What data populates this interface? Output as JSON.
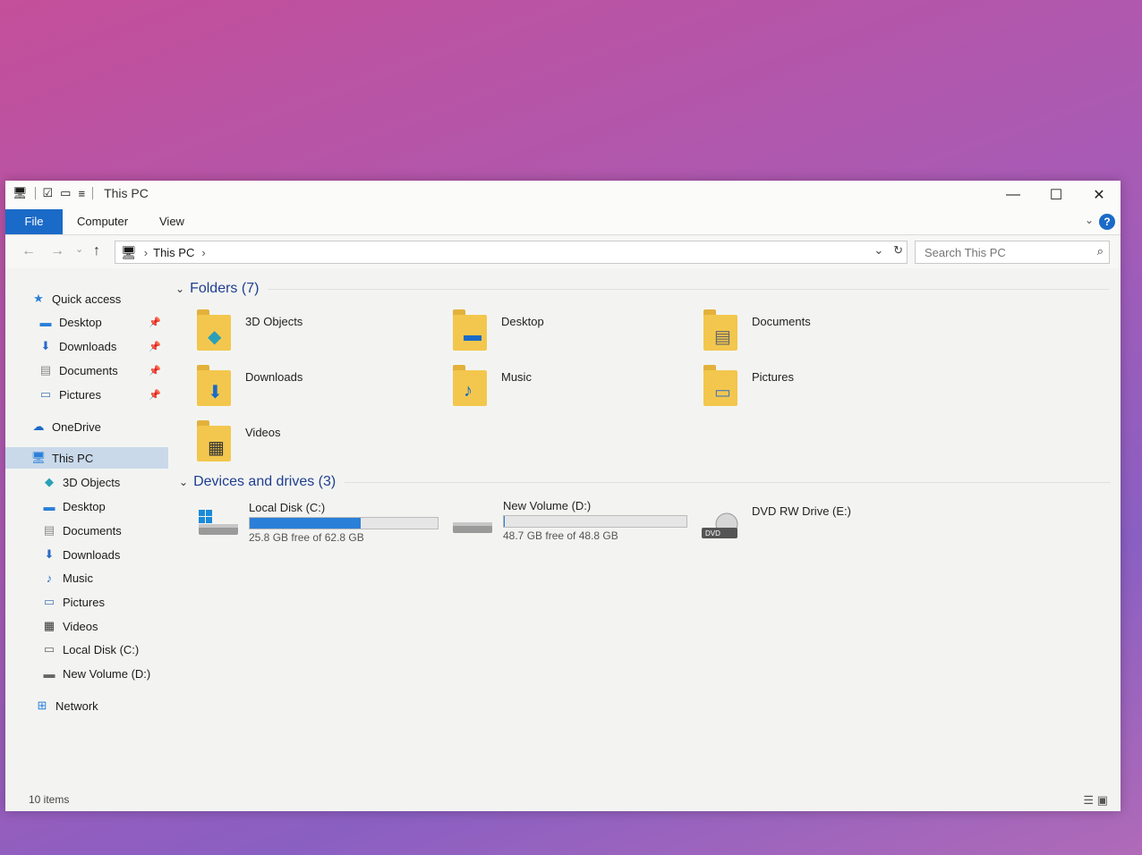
{
  "window": {
    "title": "This PC",
    "minimize_glyph": "—",
    "maximize_glyph": "☐",
    "close_glyph": "✕"
  },
  "ribbon": {
    "file_label": "File",
    "computer_label": "Computer",
    "view_label": "View",
    "help_glyph": "?"
  },
  "address": {
    "crumb": "This PC",
    "search_placeholder": "Search This PC"
  },
  "sidebar": {
    "quick_access": "Quick access",
    "quick_items": [
      {
        "label": "Desktop",
        "icon": "desktop-icon"
      },
      {
        "label": "Downloads",
        "icon": "downloads-icon"
      },
      {
        "label": "Documents",
        "icon": "documents-icon"
      },
      {
        "label": "Pictures",
        "icon": "pictures-icon"
      }
    ],
    "onedrive": "OneDrive",
    "this_pc": "This PC",
    "pc_items": [
      {
        "label": "3D Objects"
      },
      {
        "label": "Desktop"
      },
      {
        "label": "Documents"
      },
      {
        "label": "Downloads"
      },
      {
        "label": "Music"
      },
      {
        "label": "Pictures"
      },
      {
        "label": "Videos"
      },
      {
        "label": "Local Disk (C:)"
      },
      {
        "label": "New Volume (D:)"
      }
    ],
    "network": "Network"
  },
  "main": {
    "folders_header": "Folders (7)",
    "folders": [
      {
        "label": "3D Objects"
      },
      {
        "label": "Desktop"
      },
      {
        "label": "Documents"
      },
      {
        "label": "Downloads"
      },
      {
        "label": "Music"
      },
      {
        "label": "Pictures"
      },
      {
        "label": "Videos"
      }
    ],
    "drives_header": "Devices and drives (3)",
    "drives": [
      {
        "name": "Local Disk (C:)",
        "free": "25.8 GB free of 62.8 GB",
        "used_fraction": 0.59
      },
      {
        "name": "New Volume (D:)",
        "free": "48.7 GB free of 48.8 GB",
        "used_fraction": 0.002
      },
      {
        "name": "DVD RW Drive (E:)"
      }
    ]
  },
  "status": {
    "item_count": "10 items"
  },
  "colors": {
    "accent": "#1a6ac7",
    "drive_bar": "#2a7fd8",
    "folder_yellow": "#f3c74e"
  }
}
